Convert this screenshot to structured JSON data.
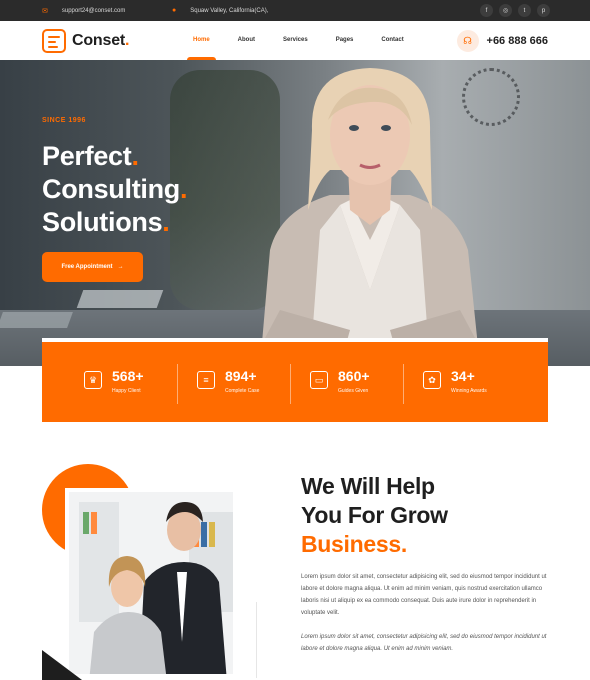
{
  "topbar": {
    "email": "support24@conset.com",
    "address": "Squaw Valley, California(CA),",
    "socials": [
      "f",
      "◎",
      "t",
      "p"
    ]
  },
  "nav": {
    "logo": "Conset",
    "menu": [
      "Home",
      "About",
      "Services",
      "Pages",
      "Contact"
    ],
    "active": "Home",
    "phone": "+66 888 666"
  },
  "hero": {
    "since": "SINCE 1996",
    "line1": "Perfect",
    "line2": "Consulting",
    "line3": "Solutions",
    "cta": "Free Appointment"
  },
  "stats": [
    {
      "icon": "trophy-icon",
      "value": "568+",
      "label": "Happy Client"
    },
    {
      "icon": "case-icon",
      "value": "894+",
      "label": "Complete Case"
    },
    {
      "icon": "monitor-icon",
      "value": "860+",
      "label": "Guides Given"
    },
    {
      "icon": "award-icon",
      "value": "34+",
      "label": "Winning Awards"
    }
  ],
  "about": {
    "line1": "We Will Help",
    "line2": "You For Grow",
    "line3": "Business",
    "para1": "Lorem ipsum dolor sit amet, consectetur adipisicing elit, sed do eiusmod tempor incididunt ut labore et dolore magna aliqua. Ut enim ad minim veniam, quis nostrud exercitation ullamco laboris nisi ut aliquip ex ea commodo consequat. Duis aute irure dolor in reprehenderit in voluptate velit.",
    "para2": "Lorem ipsum dolor sit amet, consectetur adipisicing elit, sed do eiusmod tempor incididunt ut labore et dolore magna aliqua. Ut enim ad minim veniam."
  },
  "colors": {
    "accent": "#ff6b00",
    "dark": "#2b2b2b"
  }
}
